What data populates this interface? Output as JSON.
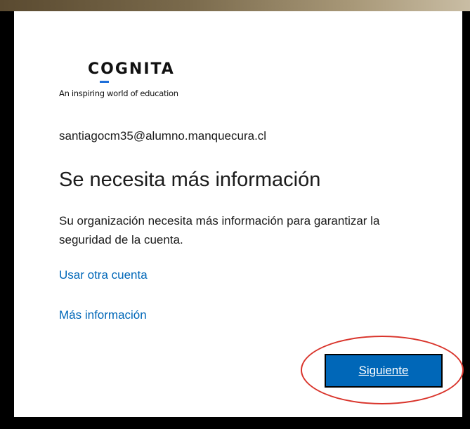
{
  "logo": {
    "wordmark": "COGNITA",
    "tagline": "An inspiring world of education"
  },
  "identity": {
    "email": "santiagocm35@alumno.manquecura.cl"
  },
  "main": {
    "title": "Se necesita más información",
    "description": "Su organización necesita más información para garantizar la seguridad de la cuenta.",
    "use_other_account_link": "Usar otra cuenta",
    "more_info_link": "Más información"
  },
  "actions": {
    "next_label": "Siguiente"
  },
  "colors": {
    "accent": "#0067b8",
    "highlight": "#d9342b",
    "logo_accent": "#1e6fd9"
  }
}
